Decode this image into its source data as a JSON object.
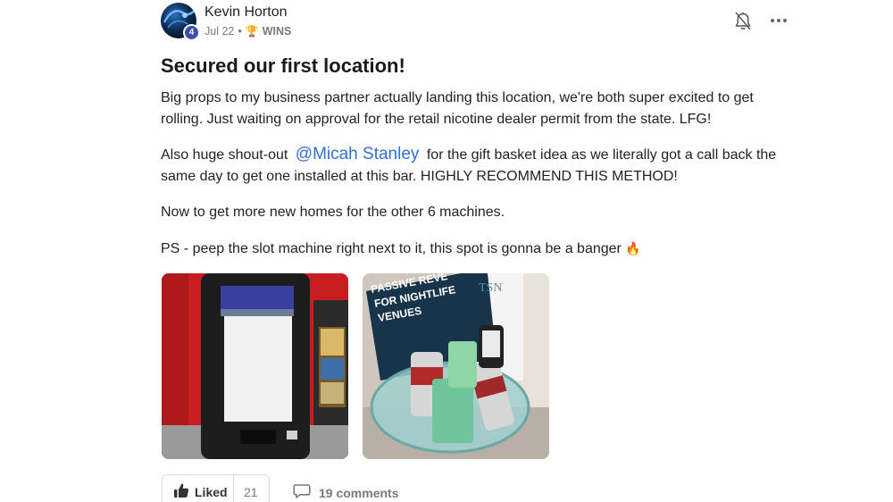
{
  "author": {
    "name": "Kevin Horton",
    "level": "4",
    "date": "Jul 22",
    "separator": "•",
    "category": "WINS"
  },
  "post": {
    "title": "Secured our first location!",
    "paragraph1": "Big props to my business partner actually landing this location, we're both super excited to get rolling. Just waiting on approval for the retail nicotine dealer permit from the state. LFG!",
    "paragraph2_before": "Also huge shout-out",
    "mention": "@Micah Stanley",
    "paragraph2_after": "for the gift basket idea as we literally got a call back the same day to get one installed at this bar. HIGHLY RECOMMEND THIS METHOD!",
    "paragraph3": "Now to get more new homes for the other 6 machines.",
    "paragraph4": "PS - peep the slot machine right next to it, this spot is gonna be a banger",
    "emoji": "🔥"
  },
  "images": [
    {
      "name": "vending-machine-photo"
    },
    {
      "name": "gift-basket-photo",
      "sign_line1": "PASSIVE REVE",
      "sign_line2": "FOR NIGHTLIFE",
      "sign_line3": "VENUES",
      "logo": "TSN"
    }
  ],
  "footer": {
    "like_label": "Liked",
    "like_count": "21",
    "comments_label": "19 comments"
  },
  "icons": {
    "bell": "bell-icon",
    "more": "more-options-icon",
    "trophy": "trophy-icon",
    "thumbs_up": "thumbs-up-icon",
    "comment": "comment-icon"
  },
  "colors": {
    "mention": "#2f6fd6",
    "level_badge": "#3b4ea8",
    "meta_text": "#7a7a7a"
  }
}
